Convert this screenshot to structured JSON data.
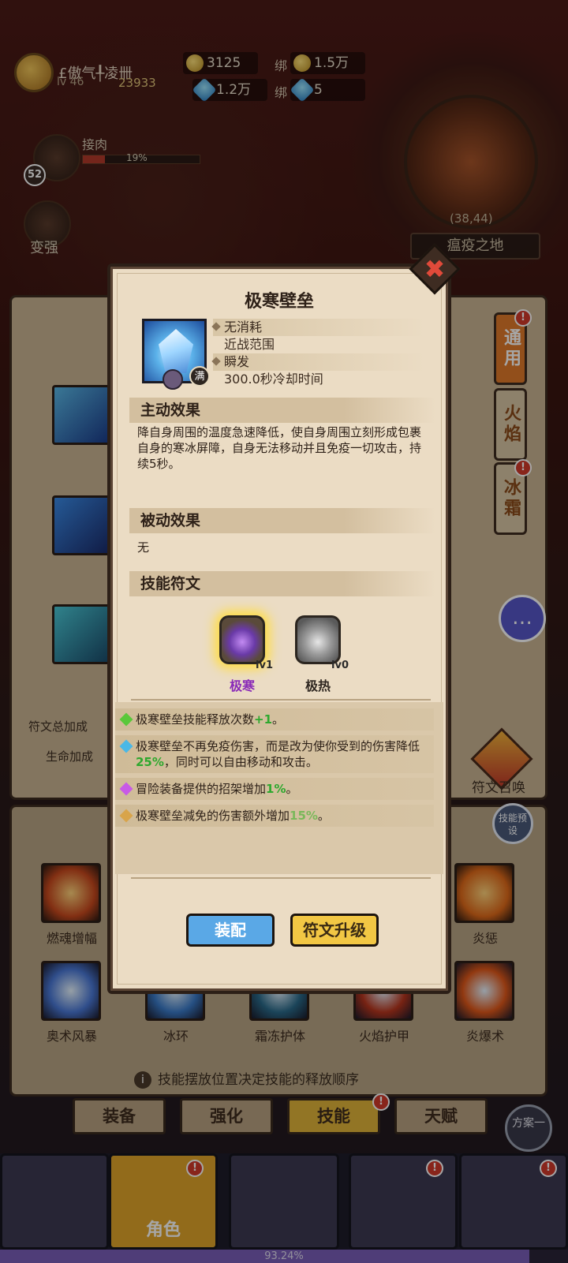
{
  "hud": {
    "player_name": "£傲气╀凌卌",
    "player_level": "lv 46",
    "power": "23933",
    "gold": "3125",
    "bound_label_1": "绑",
    "bound_gold": "1.5万",
    "gems": "1.2万",
    "bound_label_2": "绑",
    "bound_gems": "5",
    "quest_label": "接肉",
    "quest_progress_text": "19%",
    "quest_progress_value": 19,
    "level_badge": "52",
    "strengthen_label": "变强",
    "map_coord": "(38,44)",
    "map_name": "瘟疫之地"
  },
  "skill_panel": {
    "side_tabs": [
      "通用",
      "火焰",
      "冰霜"
    ],
    "rune_total_label": "符文总加成",
    "life_bonus_label": "生命加成",
    "chat_icon": "chat-bubble-icon",
    "rune_summon_label": "符文召唤",
    "preset_label": "技能预设",
    "skills_row1": [
      {
        "label": "燃魂增幅",
        "color": "#c8491e"
      },
      {
        "label": "炎惩",
        "color": "#e06a1a"
      }
    ],
    "skills_row2": [
      {
        "label": "奥术风暴",
        "color": "#4a78d6"
      },
      {
        "label": "冰环",
        "color": "#3a7ac8"
      },
      {
        "label": "霜冻护体",
        "color": "#2a6a8a"
      },
      {
        "label": "火焰护甲",
        "color": "#b8361e"
      },
      {
        "label": "炎爆术",
        "color": "#e0581a"
      }
    ],
    "hint": "技能摆放位置决定技能的释放顺序",
    "hint_icon": "info-icon",
    "sub_tabs": [
      "装备",
      "强化",
      "技能",
      "天赋"
    ],
    "plan_label": "方案一"
  },
  "bottom_nav": {
    "items": [
      "",
      "角色",
      "",
      "",
      ""
    ],
    "exp_text": "93.24%",
    "exp_value": 93.24
  },
  "dialog": {
    "title": "极寒壁垒",
    "info": [
      "无消耗",
      "近战范围",
      "瞬发",
      "300.0秒冷却时间"
    ],
    "max_badge": "满",
    "active_header": "主动效果",
    "active_desc": "降自身周围的温度急速降低，使自身周围立刻形成包裹自身的寒冰屏障，自身无法移动并且免疫一切攻击，持续5秒。",
    "passive_header": "被动效果",
    "passive_desc": "无",
    "rune_header": "技能符文",
    "runes": [
      {
        "name": "极寒",
        "level": "lv1",
        "selected": true
      },
      {
        "name": "极热",
        "level": "lv0",
        "selected": false
      }
    ],
    "effects": [
      {
        "pre": "极寒壁垒技能释放次数",
        "hl": "+1",
        "post": "。",
        "gem_color": "#5ac83a"
      },
      {
        "pre": "极寒壁垒不再免疫伤害，而是改为使你受到的伤害降低",
        "hl": "25%",
        "post": "，同时可以自由移动和攻击。",
        "gem_color": "#4ab8e6"
      },
      {
        "pre": "冒险装备提供的招架增加",
        "hl": "1%",
        "post": "。",
        "gem_color": "#c85ae6"
      },
      {
        "pre": "极寒壁垒减免的伤害额外增加",
        "hl": "15%",
        "post": "。",
        "gem_color": "#d8a44a"
      }
    ],
    "equip_button": "装配",
    "upgrade_button": "符文升级",
    "close_icon": "close-icon"
  }
}
